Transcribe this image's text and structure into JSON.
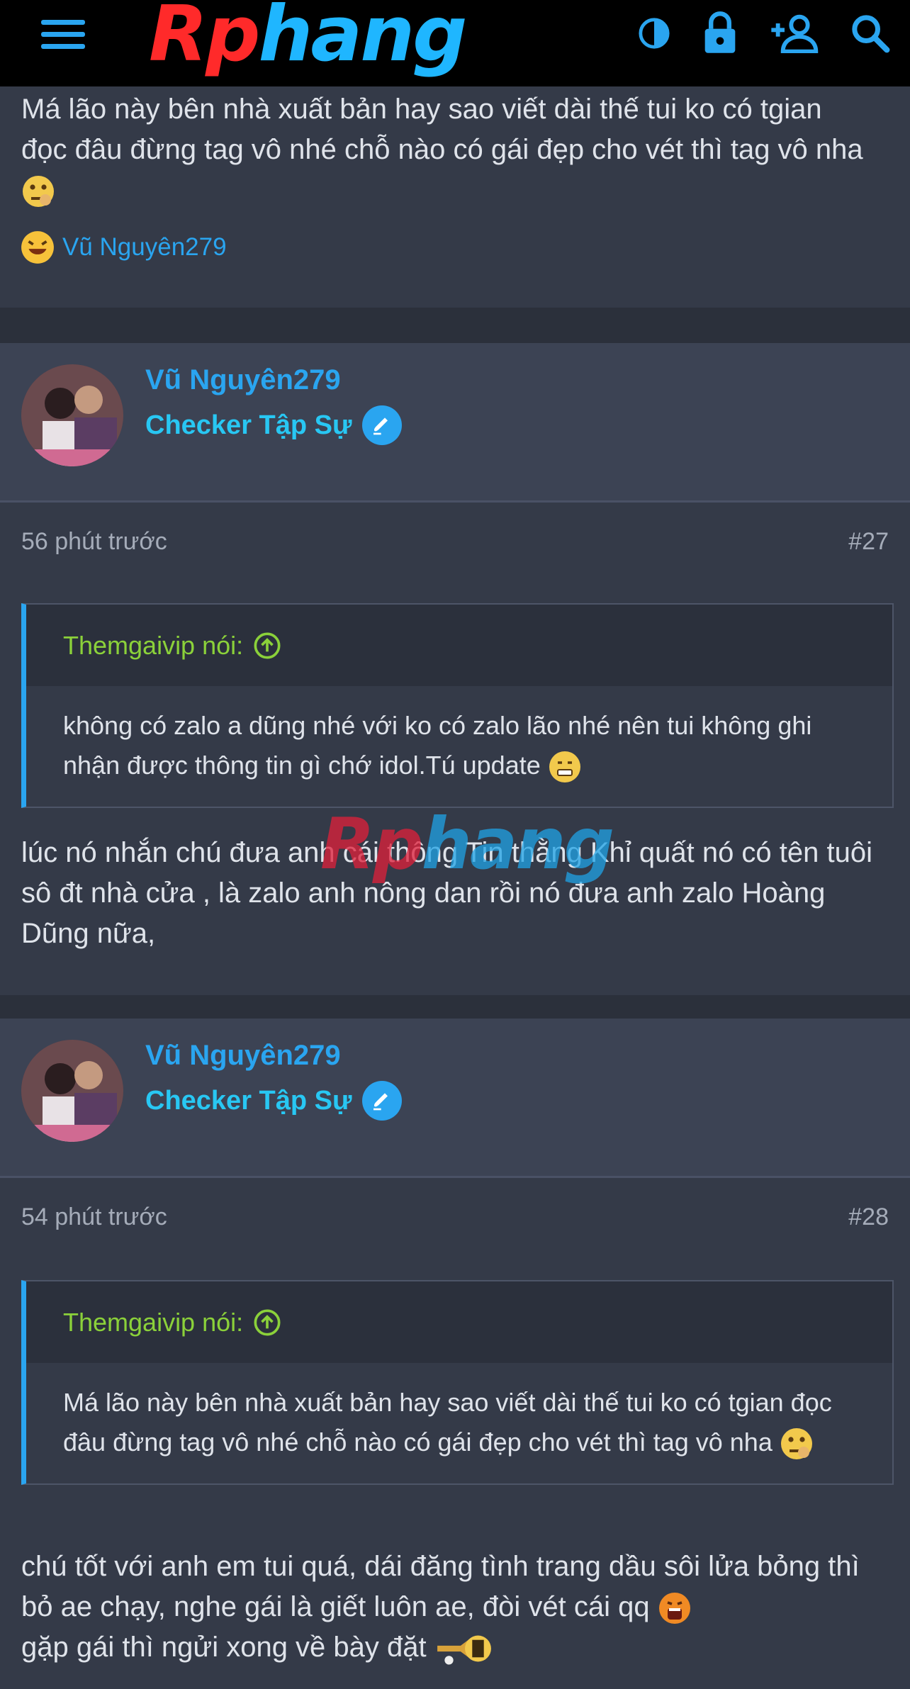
{
  "header": {
    "logo_text_red": "Rp",
    "logo_text_blue": "hang",
    "icons": [
      "menu-icon",
      "theme-toggle-icon",
      "lock-icon",
      "add-user-icon",
      "search-icon"
    ],
    "accent_color": "#2aa5f0"
  },
  "top_post": {
    "text": "Má lão này bên nhà xuất bản hay sao viết dài thế tui ko có tgian đọc đâu đừng tag vô nhé chỗ nào có gái đẹp cho vét thì tag vô nha",
    "reaction_user": "Vũ Nguyên279"
  },
  "posts": [
    {
      "username": "Vũ Nguyên279",
      "user_title": "Checker Tập Sự",
      "time": "56 phút trước",
      "number": "#27",
      "quote_author": "Themgaivip nói:",
      "quote_text": "không có zalo a dũng nhé với ko có zalo lão nhé nên tui không ghi nhận được thông tin gì chớ idol.Tú update",
      "body": "lúc nó nhắn chú đưa anh cái thông Tin thằng Khỉ quất nó có tên tuôi sô đt nhà cửa , là zalo anh nông dan rồi nó đưa anh zalo Hoàng Dũng nữa,"
    },
    {
      "username": "Vũ Nguyên279",
      "user_title": "Checker Tập Sự",
      "time": "54 phút trước",
      "number": "#28",
      "quote_author": "Themgaivip nói:",
      "quote_text": "Má lão này bên nhà xuất bản hay sao viết dài thế tui ko có tgian đọc đâu đừng tag vô nhé chỗ nào có gái đẹp cho vét thì tag vô nha",
      "body_line1": "chú tốt với anh em tui quá, dái đăng tình trang dầu sôi lửa bỏng thì bỏ ae chạy, nghe gái là giết luôn ae, đòi vét cái qq",
      "body_line2": "gặp gái thì ngửi xong về bày đặt"
    }
  ],
  "watermark": {
    "red": "Rp",
    "blue": "hang"
  }
}
